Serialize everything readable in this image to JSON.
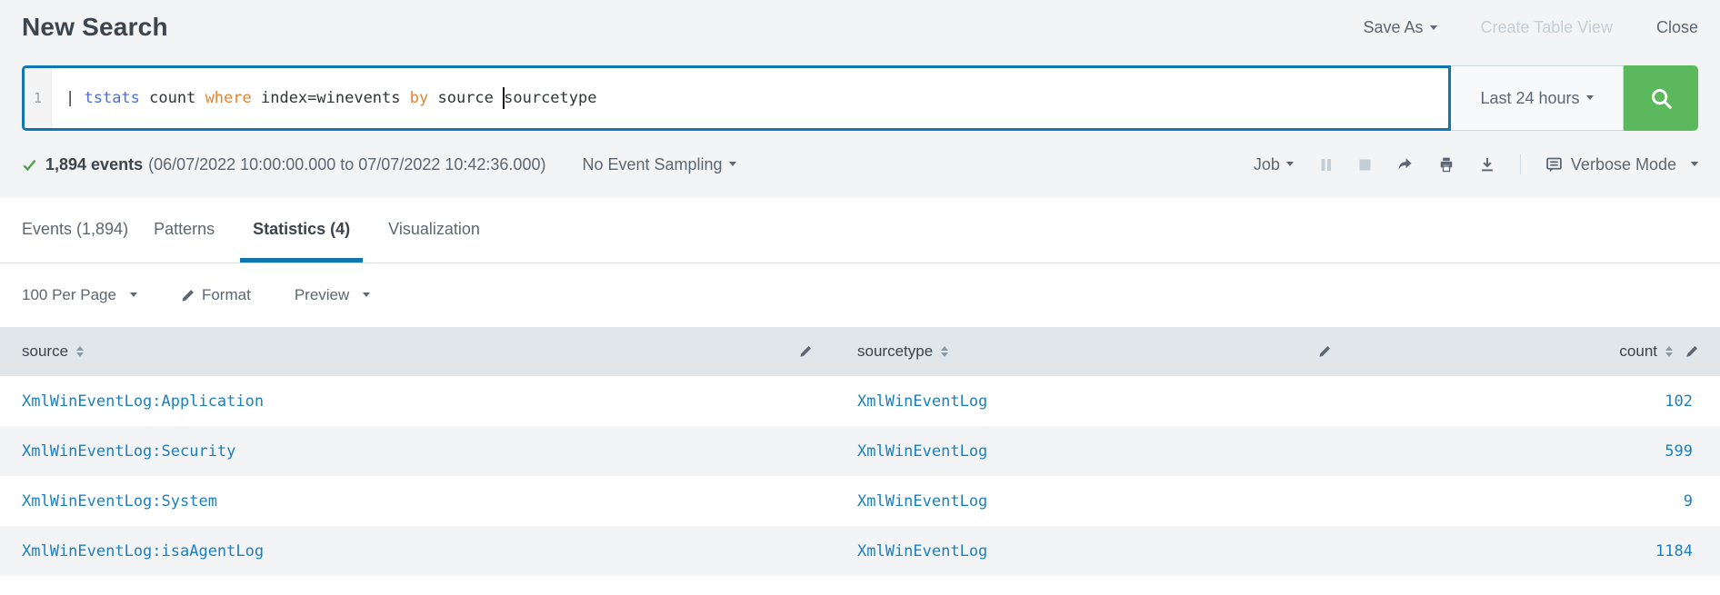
{
  "header": {
    "title": "New Search",
    "save_as": "Save As",
    "create_table_view": "Create Table View",
    "close": "Close"
  },
  "search": {
    "line_number": "1",
    "query": {
      "pipe": "| ",
      "command": "tstats",
      "text1": " count ",
      "keyword1": "where",
      "text2": " index=winevents ",
      "keyword2": "by",
      "text3": " source ",
      "text4": "sourcetype"
    },
    "time_range": "Last 24 hours"
  },
  "job_bar": {
    "events_count": "1,894 events",
    "time_span": "(06/07/2022 10:00:00.000 to 07/07/2022 10:42:36.000)",
    "sampling": "No Event Sampling",
    "job": "Job",
    "mode": "Verbose Mode"
  },
  "tabs": {
    "events": "Events (1,894)",
    "patterns": "Patterns",
    "statistics": "Statistics (4)",
    "visualization": "Visualization"
  },
  "toolbar": {
    "per_page": "100 Per Page",
    "format": "Format",
    "preview": "Preview"
  },
  "table": {
    "columns": {
      "source": "source",
      "sourcetype": "sourcetype",
      "count": "count"
    },
    "rows": [
      {
        "source": "XmlWinEventLog:Application",
        "sourcetype": "XmlWinEventLog",
        "count": "102"
      },
      {
        "source": "XmlWinEventLog:Security",
        "sourcetype": "XmlWinEventLog",
        "count": "599"
      },
      {
        "source": "XmlWinEventLog:System",
        "sourcetype": "XmlWinEventLog",
        "count": "9"
      },
      {
        "source": "XmlWinEventLog:isaAgentLog",
        "sourcetype": "XmlWinEventLog",
        "count": "1184"
      }
    ]
  },
  "colors": {
    "accent_blue": "#1176b0",
    "link_blue": "#1c80be",
    "button_green": "#5cb85c",
    "success_green": "#53a051",
    "command_blue": "#4a70d8",
    "keyword_orange": "#e8832d",
    "header_row_bg": "#e1e6eb",
    "top_section_bg": "#f2f4f5"
  }
}
